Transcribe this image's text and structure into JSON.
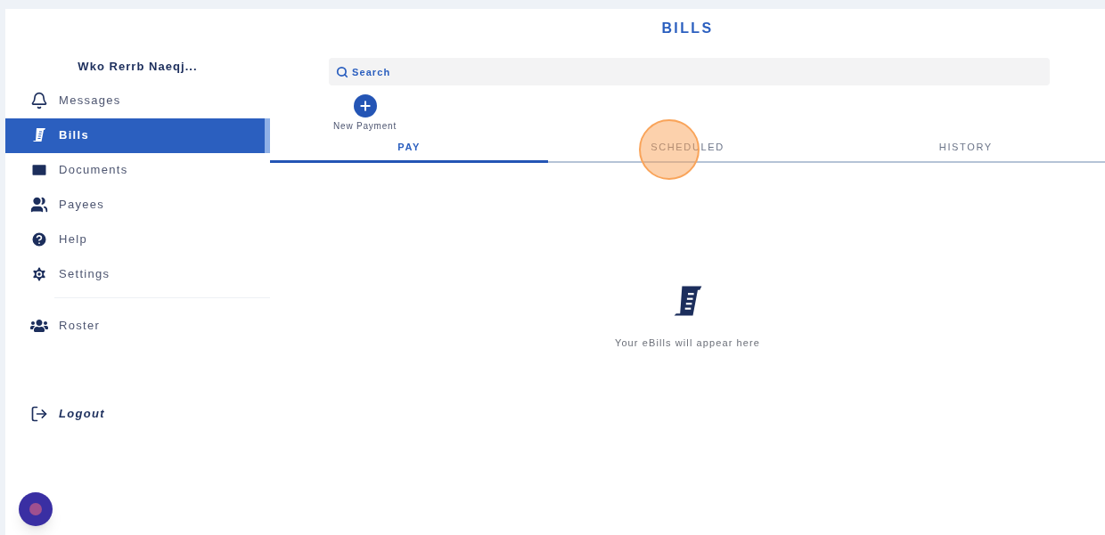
{
  "sidebar": {
    "user_name": "Wko Rerrb Naeqj...",
    "items": [
      {
        "label": "Messages",
        "selected": false
      },
      {
        "label": "Bills",
        "selected": true
      },
      {
        "label": "Documents",
        "selected": false
      },
      {
        "label": "Payees",
        "selected": false
      },
      {
        "label": "Help",
        "selected": false
      },
      {
        "label": "Settings",
        "selected": false
      }
    ],
    "secondary_items": [
      {
        "label": "Roster",
        "selected": false
      }
    ],
    "logout": "Logout"
  },
  "main": {
    "title": "BILLS",
    "search": {
      "placeholder": "Search"
    },
    "new_payment": "New Payment",
    "tabs": [
      {
        "label": "PAY",
        "selected": true
      },
      {
        "label": "SCHEDULED",
        "selected": false
      },
      {
        "label": "HISTORY",
        "selected": false
      }
    ],
    "empty_message": "Your eBills will appear here"
  }
}
